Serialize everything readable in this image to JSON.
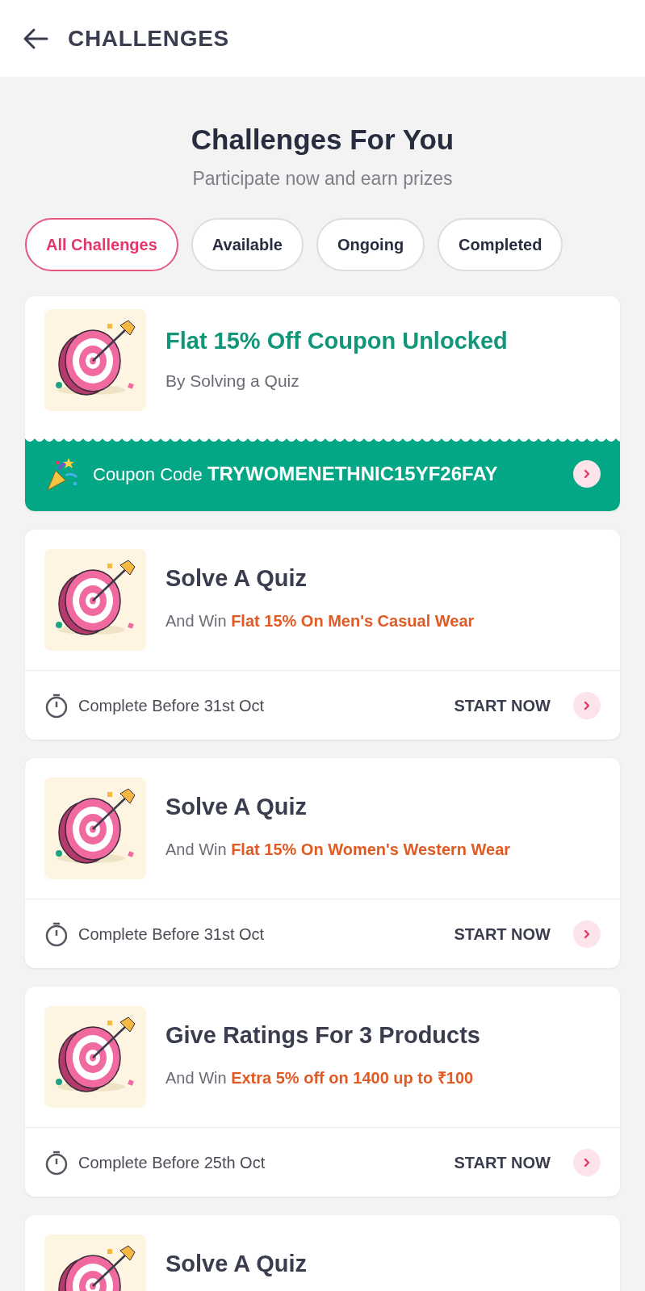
{
  "header": {
    "title": "CHALLENGES"
  },
  "intro": {
    "title": "Challenges For You",
    "subtitle": "Participate now and earn prizes"
  },
  "filters": [
    {
      "label": "All Challenges",
      "selected": true
    },
    {
      "label": "Available",
      "selected": false
    },
    {
      "label": "Ongoing",
      "selected": false
    },
    {
      "label": "Completed",
      "selected": false
    }
  ],
  "challenges": [
    {
      "kind": "coupon",
      "title": "Flat 15% Off Coupon Unlocked",
      "subtitle": "By Solving a Quiz",
      "coupon_label": "Coupon Code",
      "coupon_code": "TRYWOMENETHNIC15YF26FAY"
    },
    {
      "kind": "task",
      "title": "Solve A Quiz",
      "prefix": "And Win",
      "reward": "Flat 15% On Men's Casual Wear",
      "deadline": "Complete Before 31st Oct",
      "action": "START NOW"
    },
    {
      "kind": "task",
      "title": "Solve A Quiz",
      "prefix": "And Win",
      "reward": "Flat 15% On Women's Western Wear",
      "deadline": "Complete Before 31st Oct",
      "action": "START NOW"
    },
    {
      "kind": "task",
      "title": "Give Ratings For 3 Products",
      "prefix": "And Win",
      "reward": "Extra 5% off on 1400 up to ₹100",
      "deadline": "Complete Before 25th Oct",
      "action": "START NOW"
    },
    {
      "kind": "task",
      "title": "Solve A Quiz"
    }
  ]
}
